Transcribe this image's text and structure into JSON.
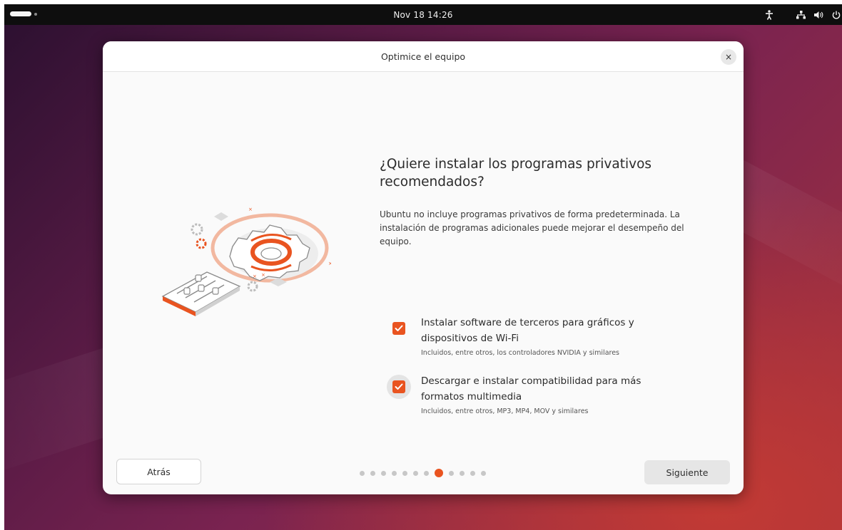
{
  "topbar": {
    "clock": "Nov 18  14:26",
    "icons": [
      "activities-indicator",
      "accessibility-icon",
      "network-icon",
      "volume-icon",
      "power-icon"
    ]
  },
  "dialog": {
    "title": "Optimice el equipo",
    "close_label": "×",
    "question": "¿Quiere instalar los programas privativos recomendados?",
    "description": "Ubuntu no incluye programas privativos de forma predeterminada. La instalación de programas adicionales puede mejorar el desempeño del equipo.",
    "options": [
      {
        "label": "Instalar software de terceros para gráficos y dispositivos de Wi-Fi",
        "sublabel": "Incluidos, entre otros, los controladores NVIDIA y similares",
        "checked": true
      },
      {
        "label": "Descargar e instalar compatibilidad para más formatos multimedia",
        "sublabel": "Incluidos, entre otros, MP3, MP4, MOV y similares",
        "checked": true
      }
    ],
    "back_label": "Atrás",
    "next_label": "Siguiente",
    "pagination": {
      "total": 12,
      "current": 8
    }
  },
  "colors": {
    "accent": "#e95420",
    "topbar": "#0e0e0e",
    "dialog_bg": "#fafafa"
  }
}
